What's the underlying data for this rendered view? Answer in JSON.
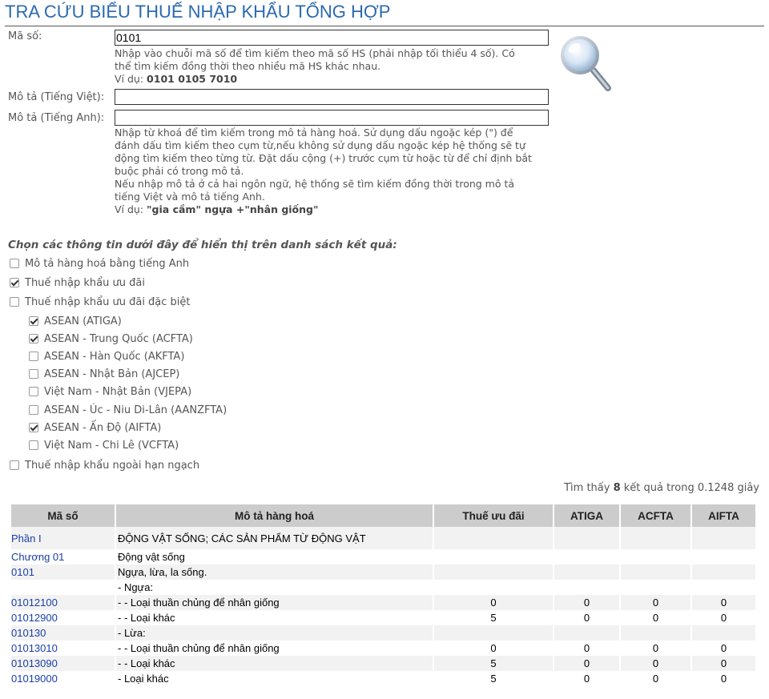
{
  "page": {
    "title": "TRA CỨU BIỂU THUẾ NHẬP KHẨU TỔNG HỢP"
  },
  "search": {
    "code_label": "Mã số:",
    "code_value": "0101",
    "code_help_line1": "Nhập vào chuỗi mã số để tìm kiếm theo mã số HS (phải nhập tối thiểu 4 số). Có",
    "code_help_line2": "thể tìm kiếm đồng thời theo nhiều mã HS khác nhau.",
    "code_example_prefix": "Ví dụ: ",
    "code_example": "0101 0105 7010",
    "desc_vi_label": "Mô tả (Tiếng Việt):",
    "desc_vi_value": "",
    "desc_en_label": "Mô tả (Tiếng Anh):",
    "desc_en_value": "",
    "desc_help_lines": [
      "Nhập từ khoá để tìm kiếm trong mô tả hàng hoá. Sử dụng dấu ngoặc kép (\") để",
      "đánh dấu tìm kiếm theo cụm từ,nếu không sử dụng dấu ngoặc kép hệ thống sẽ tự",
      "động tìm kiếm theo từng từ. Đặt dấu cộng (+) trước cụm từ hoặc từ để chỉ định bắt",
      "buộc phải có trong mô tả.",
      "Nếu nhập mô tả ở cả hai ngôn ngữ, hệ thống sẽ tìm kiếm đồng thời trong mô tả",
      "tiếng Việt và mô tả tiếng Anh."
    ],
    "desc_example_prefix": "Ví dụ: ",
    "desc_example": "\"gia cầm\" ngựa +\"nhân giống\"",
    "search_icon": "magnifier-icon"
  },
  "options": {
    "title": "Chọn các thông tin dưới đây để hiển thị trên danh sách kết quả:",
    "items": [
      {
        "label": "Mô tả hàng hoá bằng tiếng Anh",
        "checked": false
      },
      {
        "label": "Thuế nhập khẩu ưu đãi",
        "checked": true
      },
      {
        "label": "Thuế nhập khẩu ưu đãi đặc biệt",
        "checked": false
      }
    ],
    "sub_items": [
      {
        "label": "ASEAN (ATIGA)",
        "checked": true
      },
      {
        "label": "ASEAN - Trung Quốc (ACFTA)",
        "checked": true
      },
      {
        "label": "ASEAN - Hàn Quốc (AKFTA)",
        "checked": false
      },
      {
        "label": "ASEAN - Nhật Bản (AJCEP)",
        "checked": false
      },
      {
        "label": "Việt Nam - Nhật Bản (VJEPA)",
        "checked": false
      },
      {
        "label": "ASEAN - Úc - Niu Di-Lân (AANZFTA)",
        "checked": false
      },
      {
        "label": "ASEAN - Ấn Độ (AIFTA)",
        "checked": true
      },
      {
        "label": "Việt Nam - Chi Lê (VCFTA)",
        "checked": false
      }
    ],
    "last_item": {
      "label": "Thuế nhập khẩu ngoài hạn ngạch",
      "checked": false
    }
  },
  "results": {
    "info_prefix": "Tìm thấy ",
    "count": "8",
    "info_suffix": " kết quả trong 0.1248 giây",
    "headers": [
      "Mã số",
      "Mô tả hàng hoá",
      "Thuế ưu đãi",
      "ATIGA",
      "ACFTA",
      "AIFTA"
    ],
    "rows": [
      {
        "code": "Phần I",
        "desc": "ĐỘNG VẬT SỐNG; CÁC SẢN PHẨM TỪ ĐỘNG VẬT",
        "mfn": "",
        "atiga": "",
        "acfta": "",
        "aifta": ""
      },
      {
        "code": "Chương 01",
        "desc": "Động vật sống",
        "mfn": "",
        "atiga": "",
        "acfta": "",
        "aifta": ""
      },
      {
        "code": "0101",
        "desc": "Ngựa, lừa, la sống.",
        "mfn": "",
        "atiga": "",
        "acfta": "",
        "aifta": ""
      },
      {
        "code": "",
        "desc": "- Ngựa:",
        "mfn": "",
        "atiga": "",
        "acfta": "",
        "aifta": ""
      },
      {
        "code": "01012100",
        "desc": "- - Loại thuần chủng để nhân giống",
        "mfn": "0",
        "atiga": "0",
        "acfta": "0",
        "aifta": "0"
      },
      {
        "code": "01012900",
        "desc": "- - Loại khác",
        "mfn": "5",
        "atiga": "0",
        "acfta": "0",
        "aifta": "0"
      },
      {
        "code": "010130",
        "desc": "- Lừa:",
        "mfn": "",
        "atiga": "",
        "acfta": "",
        "aifta": ""
      },
      {
        "code": "01013010",
        "desc": "- - Loại thuần chủng để nhân giống",
        "mfn": "0",
        "atiga": "0",
        "acfta": "0",
        "aifta": "0"
      },
      {
        "code": "01013090",
        "desc": "- - Loại khác",
        "mfn": "5",
        "atiga": "0",
        "acfta": "0",
        "aifta": "0"
      },
      {
        "code": "01019000",
        "desc": "- Loại khác",
        "mfn": "5",
        "atiga": "0",
        "acfta": "0",
        "aifta": "0"
      }
    ]
  }
}
